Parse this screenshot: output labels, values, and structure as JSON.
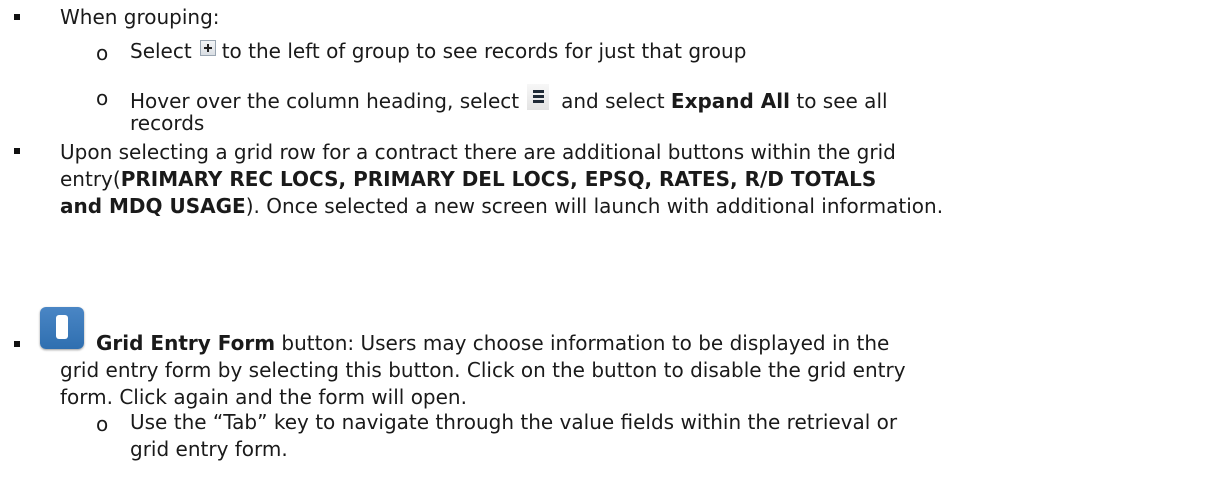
{
  "grouping": {
    "heading": "When grouping:",
    "item1_before": "Select",
    "item1_after": "to the left of group to see records for just that group",
    "item2_before": "Hover over the column heading, select",
    "item2_middle": "and select",
    "item2_bold": "Expand All",
    "item2_after": "to see all",
    "item2_line2": "records"
  },
  "grid_row": {
    "line1": "Upon selecting a grid row for a contract there are additional buttons within the grid",
    "line2_before": "entry(",
    "line2_bold": "PRIMARY REC LOCS, PRIMARY DEL LOCS, EPSQ, RATES, R/D TOTALS",
    "line3_bold": "and MDQ USAGE",
    "line3_after": "). Once selected a new screen will launch with additional information."
  },
  "grid_entry": {
    "title_bold": "Grid Entry Form",
    "line1_after": "button: Users may choose information to be displayed in the",
    "line2": "grid entry form by selecting this button. Click on the button to disable the grid entry",
    "line3": "form. Click again and the form will open.",
    "sub_line1": "Use the “Tab” key to navigate through the value fields within the retrieval or",
    "sub_line2": "grid entry form."
  },
  "icons": {
    "bullet": "square-bullet",
    "sub_bullet": "o",
    "plus": "expand-plus-icon",
    "menu": "column-menu-icon",
    "grid_button": "grid-entry-form-button-icon"
  }
}
